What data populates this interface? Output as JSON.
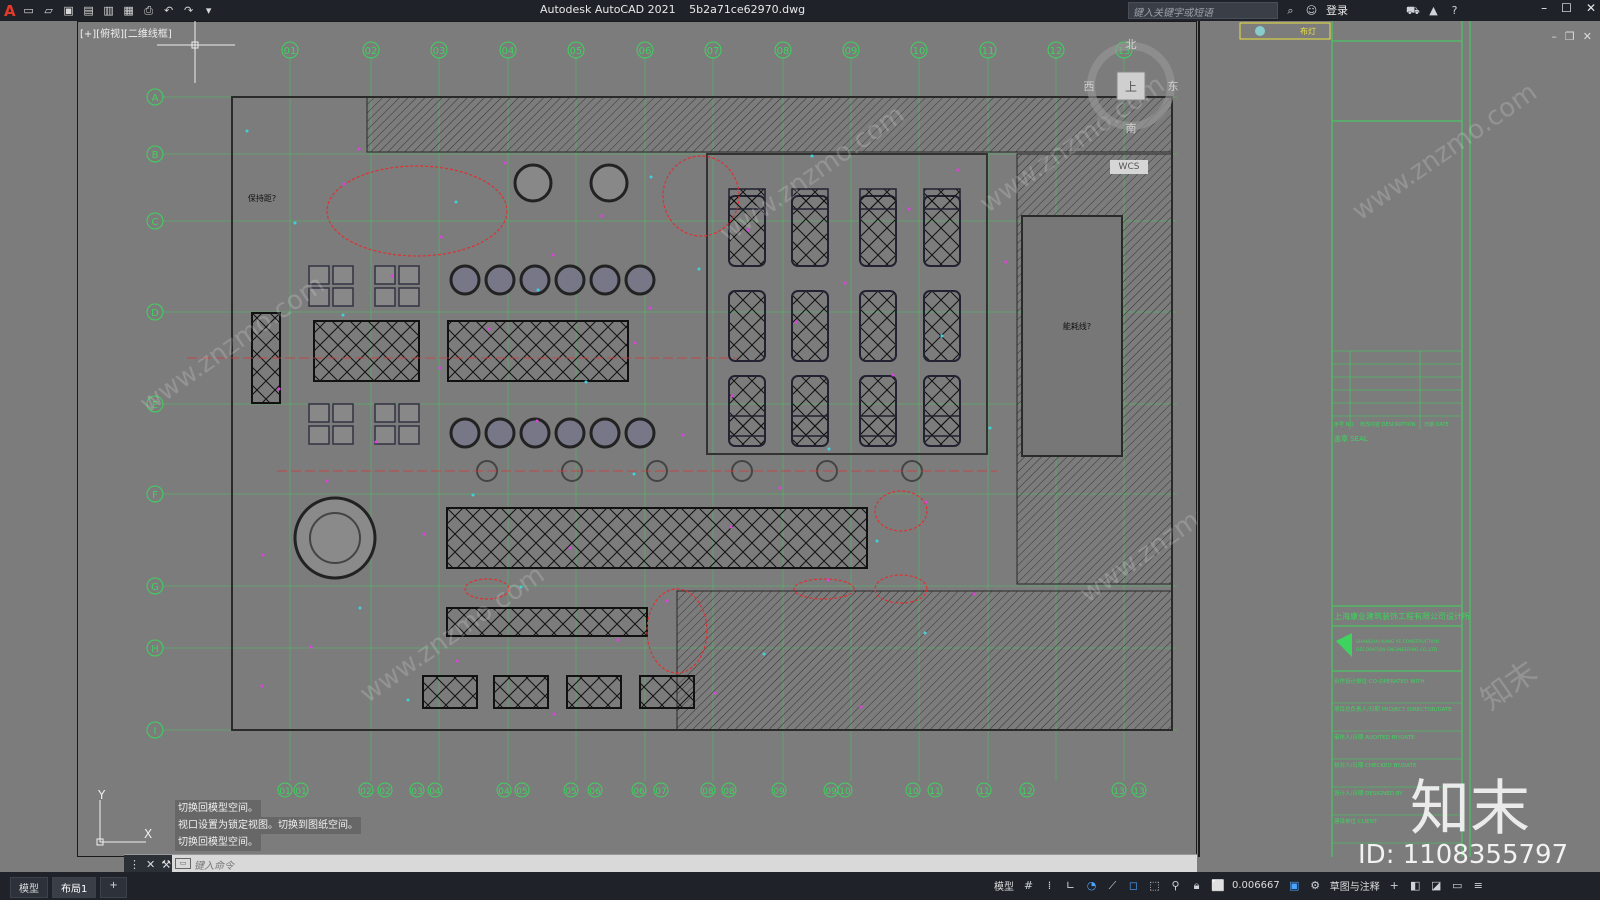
{
  "app": {
    "name": "Autodesk AutoCAD 2021",
    "file": "5b2a71ce62970.dwg",
    "search_placeholder": "键入关键字或短语",
    "login": "登录"
  },
  "viewport": {
    "label": "[+][俯视][二维线框]",
    "axis_top": [
      "01",
      "02",
      "03",
      "04",
      "05",
      "06",
      "07",
      "08",
      "09",
      "10",
      "11",
      "12",
      "13"
    ],
    "axis_bottom": [
      "01",
      "01",
      "02",
      "02",
      "03",
      "04",
      "04",
      "05",
      "05",
      "06",
      "06",
      "07",
      "08",
      "08",
      "09",
      "09",
      "10",
      "10",
      "11",
      "11",
      "12",
      "13",
      "13"
    ],
    "axis_left": [
      "A",
      "B",
      "C",
      "D",
      "E",
      "F",
      "G",
      "H",
      "I"
    ],
    "room_labels": [
      "保持距?",
      "能耗线?"
    ],
    "compass": {
      "north": "北",
      "south": "南",
      "east": "东",
      "west": "西",
      "center": "上",
      "wcs": "WCS"
    },
    "ucs_x": "X",
    "ucs_y": "Y"
  },
  "command_history": [
    "切换回模型空间。",
    "视口设置为锁定视图。切换到图纸空间。",
    "切换回模型空间。"
  ],
  "command_prompt": "键入命令",
  "layout_tabs": [
    "模型",
    "布局1"
  ],
  "status": {
    "mode": "模型",
    "scale": "0.006667",
    "workspace": "草图与注释"
  },
  "titleblock": {
    "header_label": "布灯",
    "rev_cols": [
      "序号 NO.",
      "修改内容 DESCRIPTION",
      "日期 DATE"
    ],
    "seal": "盖章 SEAL",
    "company_cn": "上海康业建筑装饰工程有限公司设计所",
    "company_en": "SHANGHAI KANG YE CONSTRUCTION DECORATION ENGINEERING CO.,LTD",
    "rows": [
      "合作设计单位 CO-OPERATED WITH",
      "项目总负责人/日期 PROJECT DIRECTOR/DATE",
      "审核人/日期 AUDITED BY/DATE",
      "校对人/日期 CHECKED BY/DATE",
      "设计人/日期 DESIGNED BY",
      "建设单位 CLIENT"
    ]
  },
  "watermark": {
    "brand": "知末",
    "id": "ID: 1108355797",
    "site": "www.znzmo.com"
  },
  "colors": {
    "background": "#7c7c7c",
    "grid_green": "#3ed35e",
    "wall": "#2a2a2a",
    "red_cloud": "#e03030",
    "magenta": "#e040e0",
    "cyan": "#40d0e0",
    "yellow": "#e8e040"
  }
}
